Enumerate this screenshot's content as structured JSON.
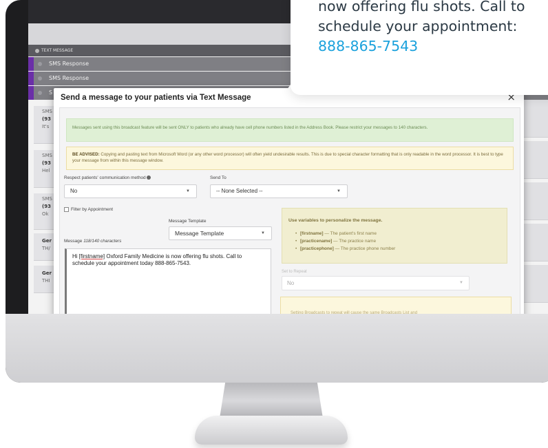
{
  "background_app": {
    "tab_label": "TEXT MESSAGE",
    "rows": [
      "SMS Response",
      "SMS Response",
      "S"
    ],
    "cards": [
      {
        "top": "SMS",
        "number": "(93",
        "text": "It's"
      },
      {
        "top": "SMS",
        "number": "(93",
        "text": "Hel"
      },
      {
        "top": "SMS",
        "number": "(93",
        "text": "Ok"
      },
      {
        "top": "Ger",
        "number": "",
        "text": "TH/"
      },
      {
        "top": "Ger",
        "number": "",
        "text": "THI"
      }
    ]
  },
  "modal": {
    "title": "Send a message to your patients via Text Message",
    "close_label": "×",
    "alert_success": "Messages sent using this broadcast feature will be sent ONLY to patients who already have cell phone numbers listed in the Address Book. Please restrict your messages to 140 characters.",
    "alert_warning_label": "BE ADVISED:",
    "alert_warning_text": " Copying and pasting text from Microsoft Word (or any other word processor) will often yield undesirable results. This is due to special character formatting that is only readable in the word processor. It is best to type your message from within this message window.",
    "respect_label": "Respect patients' communication method",
    "respect_value": "No",
    "send_to_label": "Send To",
    "send_to_value": "-- None Selected --",
    "filter_label": "Filter by Appointment",
    "template_label": "Message Template",
    "template_value": "Message Template",
    "message_label": "Message",
    "message_counter": "118/140 characters",
    "message_var": "[firstname]",
    "message_line1_rest": " Oxford Family Medicine is now offering flu shots. Call to",
    "message_prefix": "Hi ",
    "message_line2": "schedule your appointment today 888-865-7543.",
    "variables": {
      "title": "Use variables to personalize the message.",
      "items": [
        {
          "name": "[firstname]",
          "desc": " — The patient's first name"
        },
        {
          "name": "[practicename]",
          "desc": " — The practice name"
        },
        {
          "name": "[practicephone]",
          "desc": " — The practice phone number"
        }
      ]
    },
    "repeat_label": "Set to Repeat",
    "repeat_value": "No",
    "repeat_warning": "Setting Broadcasts to repeat will cause the same Broadcasts List and"
  },
  "bubble": {
    "line1": "now offering flu shots. Call to",
    "line2": "schedule your appointment:",
    "phone": "888-865-7543"
  },
  "colors": {
    "accent_purple": "#6b2fa8",
    "phone_blue": "#1aa1dc",
    "success_bg": "#dff0d5",
    "warning_bg": "#fcf7dd"
  }
}
